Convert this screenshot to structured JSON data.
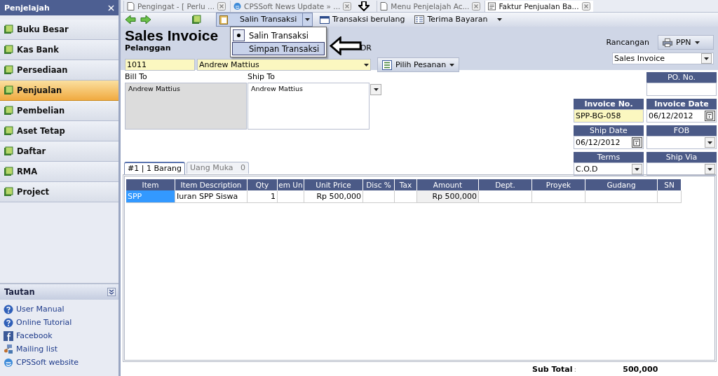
{
  "sidebar": {
    "title": "Penjelajah",
    "items": [
      {
        "label": "Buku Besar",
        "selected": false
      },
      {
        "label": "Kas Bank",
        "selected": false
      },
      {
        "label": "Persediaan",
        "selected": false
      },
      {
        "label": "Penjualan",
        "selected": true
      },
      {
        "label": "Pembelian",
        "selected": false
      },
      {
        "label": "Aset Tetap",
        "selected": false
      },
      {
        "label": "Daftar",
        "selected": false
      },
      {
        "label": "RMA",
        "selected": false
      },
      {
        "label": "Project",
        "selected": false
      }
    ],
    "links_title": "Tautan",
    "links": [
      {
        "label": "User Manual",
        "kind": "help"
      },
      {
        "label": "Online Tutorial",
        "kind": "help"
      },
      {
        "label": "Facebook",
        "kind": "facebook"
      },
      {
        "label": "Mailing list",
        "kind": "mailing"
      },
      {
        "label": "CPSSoft website",
        "kind": "web"
      }
    ]
  },
  "tabs": [
    {
      "label": "Pengingat - [ Perlu ...",
      "kind": "page",
      "selected": false
    },
    {
      "label": "CPSSoft News Update » ...",
      "kind": "web",
      "selected": false
    },
    {
      "label": "Menu Penjelajah Ac...",
      "kind": "page",
      "selected": false
    },
    {
      "label": "Faktur Penjualan Ba...",
      "kind": "form",
      "selected": true
    }
  ],
  "toolbar": {
    "copy_button": "Salin Transaksi",
    "recurring_button": "Transaksi berulang",
    "payment_button": "Terima Bayaran"
  },
  "menu": [
    {
      "label": "Salin Transaksi",
      "checked": true,
      "selected": false
    },
    {
      "label": "Simpan Transaksi",
      "checked": false,
      "selected": true
    }
  ],
  "form": {
    "title": "Sales Invoice",
    "customer_label": "Pelanggan",
    "customer_id": "1011",
    "customer_name": "Andrew Mattius",
    "currency": "DR",
    "order_button": "Pilih Pesanan",
    "template_label": "Rancangan",
    "print_button": "PPN",
    "template": "Sales Invoice",
    "bill_to_label": "Bill To",
    "bill_to": "Andrew Mattius",
    "ship_to_label": "Ship To",
    "ship_to": "Andrew Mattius",
    "fields": [
      {
        "label": "PO. No.",
        "kind": "text",
        "highlight": false,
        "bold": false
      },
      {
        "label": "Invoice No.",
        "value": "SPP-BG-058",
        "kind": "text",
        "highlight": true,
        "bold": true
      },
      {
        "label": "Invoice Date",
        "value": "06/12/2012",
        "kind": "date",
        "highlight": false,
        "bold": true
      },
      {
        "label": "Ship Date",
        "value": "06/12/2012",
        "kind": "date",
        "highlight": false,
        "bold": false
      },
      {
        "label": "FOB",
        "kind": "select",
        "highlight": false,
        "bold": false
      },
      {
        "label": "Terms",
        "value": "C.O.D",
        "kind": "select",
        "highlight": false,
        "bold": false
      },
      {
        "label": "Ship Via",
        "kind": "select",
        "highlight": false,
        "bold": false
      }
    ]
  },
  "detail_tabs": [
    {
      "label": "#1 | 1 Barang",
      "selected": true
    },
    {
      "label": "Uang Muka   0",
      "selected": false
    }
  ],
  "table": {
    "columns": [
      "Item",
      "Item Description",
      "Qty",
      "em Un",
      "Unit Price",
      "Disc %",
      "Tax",
      "Amount",
      "Dept.",
      "Proyek",
      "Gudang",
      "SN"
    ],
    "rows": [
      [
        "SPP",
        "Iuran SPP Siswa",
        "1",
        "",
        "Rp 500,000",
        "",
        "",
        "Rp 500,000",
        "",
        "",
        "",
        ""
      ]
    ]
  },
  "subtotal": {
    "label": "Sub Total",
    "separator": ":",
    "value": "500,000"
  }
}
